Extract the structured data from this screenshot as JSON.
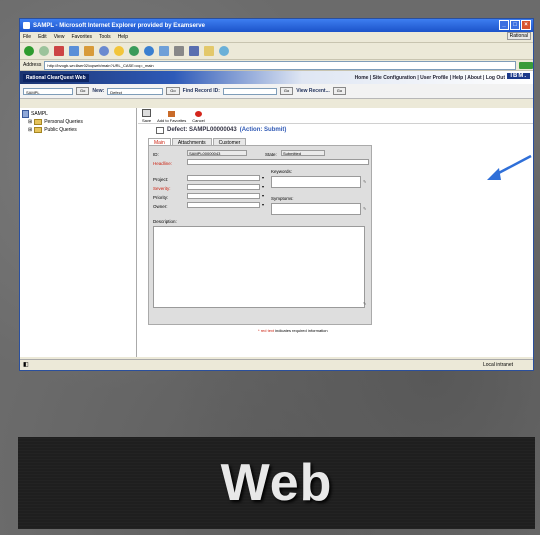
{
  "window": {
    "title": "SAMPL - Microsoft Internet Explorer provided by Examserve",
    "menu": [
      "File",
      "Edit",
      "View",
      "Favorites",
      "Tools",
      "Help"
    ],
    "brand_badge": "Rational",
    "address_label": "Address",
    "url": "http://bvogb-wn:8ser02/cqweb/main?URL_CASE=cq=_main"
  },
  "app": {
    "product": "Rational ClearQuest Web",
    "links": "Home | Site Configuration | User Profile | Help | About | Log Out",
    "logo": "IBM."
  },
  "cmdbar": {
    "db_select": "SAMPL",
    "go1": "Go",
    "new_label": "New:",
    "new_select": "Defect",
    "go2": "Go",
    "find_label": "Find Record ID:",
    "go3": "Go",
    "recent_label": "View Recent...",
    "go4": "Go"
  },
  "tree": {
    "root": "SAMPL",
    "items": [
      "Personal Queries",
      "Public Queries"
    ]
  },
  "actions": [
    "Save",
    "Add to Favorites",
    "Cancel"
  ],
  "record": {
    "title": "Defect: SAMPL00000043",
    "action": "(Action: Submit)"
  },
  "tabs": [
    "Main",
    "Attachments",
    "Customer"
  ],
  "form": {
    "id_label": "ID:",
    "id_value": "SAMPL00000043",
    "state_label": "State:",
    "state_value": "Submitted",
    "headline_label": "Headline:",
    "keywords_label": "Keywords:",
    "project_label": "Project:",
    "severity_label": "Severity:",
    "priority_label": "Priority:",
    "symptoms_label": "Symptoms:",
    "owner_label": "Owner:",
    "description_label": "Description:"
  },
  "note": {
    "star": "*",
    "red": "red text",
    "rest": "indicates required information"
  },
  "status": {
    "zone": "Local intranet"
  },
  "caption": "Web",
  "colors": {
    "title_bar": "#1c53c9",
    "required": "#cc2211",
    "action_link": "#2f59b5",
    "arrow": "#2f6fd8"
  }
}
